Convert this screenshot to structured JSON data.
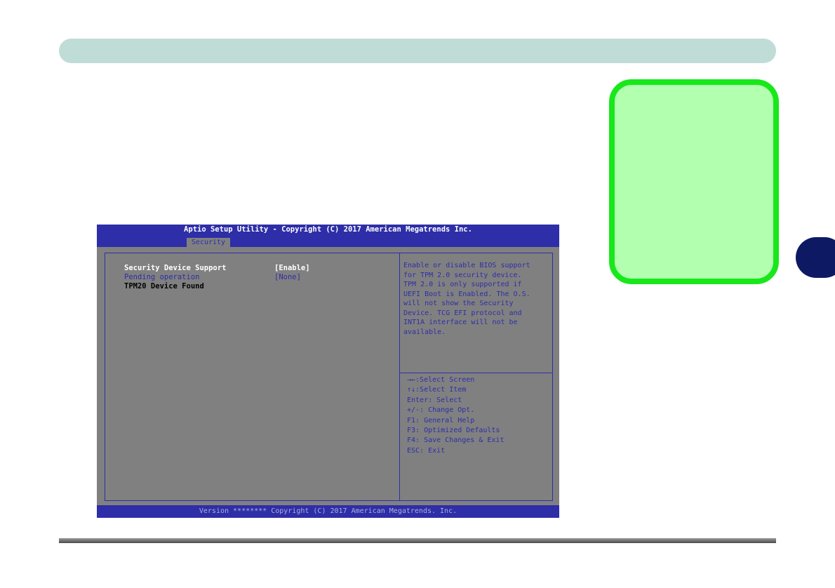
{
  "colors": {
    "top_band": "#c0dcd6",
    "note_box_fill": "#b3ffb0",
    "note_box_border": "#18e81b",
    "chapter_tab": "#0d1a63",
    "bios_blue": "#2e2ea8",
    "bios_gray": "#808080"
  },
  "bios": {
    "title": "Aptio Setup Utility - Copyright (C) 2017 American Megatrends Inc.",
    "active_tab": "Security",
    "settings": [
      {
        "label": "Security Device Support",
        "value": "[Enable]"
      },
      {
        "label": "Pending operation",
        "value": "[None]"
      },
      {
        "label": "TPM20 Device Found",
        "value": ""
      }
    ],
    "help_lines": [
      "Enable or disable BIOS support",
      "for TPM 2.0 security device.",
      "TPM 2.0 is only supported if",
      "UEFI Boot is Enabled. The O.S.",
      "will not show the Security",
      "Device. TCG EFI protocol and",
      "INT1A interface will not be",
      "available."
    ],
    "keys": [
      "→←:Select Screen",
      "↑↓:Select Item",
      "Enter: Select",
      "+/-: Change Opt.",
      "F1: General Help",
      "F3: Optimized Defaults",
      "F4: Save Changes & Exit",
      "ESC: Exit"
    ],
    "footer": "Version ******** Copyright (C) 2017 American Megatrends. Inc."
  }
}
